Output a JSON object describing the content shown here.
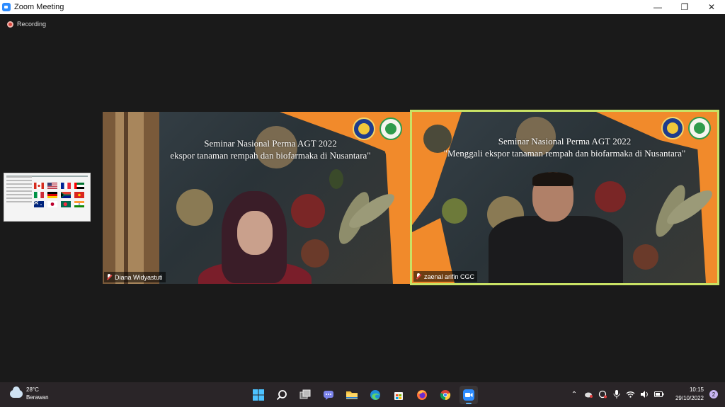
{
  "window": {
    "title": "Zoom Meeting",
    "controls": {
      "minimize": "—",
      "restore": "❐",
      "close": "✕"
    }
  },
  "meeting": {
    "recording_label": "Recording",
    "participants": [
      {
        "name": "Diana Widyastuti",
        "muted": true,
        "slide_line1": "Seminar Nasional Perma AGT 2022",
        "slide_line2": "ekspor tanaman rempah dan biofarmaka di Nusantara\""
      },
      {
        "name": "zaenal arifin CGC",
        "muted": true,
        "active_speaker": true,
        "slide_line1": "Seminar Nasional Perma AGT 2022",
        "slide_line2": "\"Menggali ekspor tanaman rempah dan biofarmaka di Nusantara\""
      }
    ],
    "accent_color": "#c9e265"
  },
  "taskbar": {
    "weather": {
      "temp": "28°C",
      "condition": "Berawan"
    },
    "time": "10:15",
    "date": "29/10/2022",
    "notifications": "2",
    "apps": [
      "start",
      "search",
      "task-view",
      "chat",
      "file-explorer",
      "edge",
      "store",
      "firefox",
      "chrome",
      "zoom"
    ]
  }
}
